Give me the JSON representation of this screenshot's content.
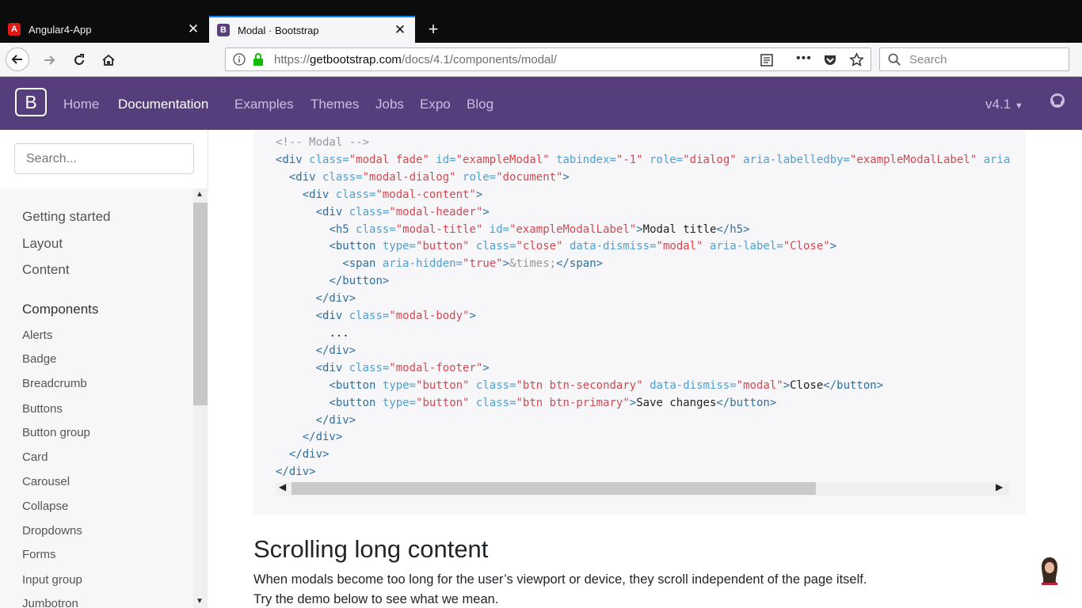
{
  "browser": {
    "tabs": [
      {
        "label": "Angular4-App",
        "icon": "angular-icon",
        "active": false
      },
      {
        "label": "Modal · Bootstrap",
        "icon": "bootstrap-icon",
        "active": true
      }
    ],
    "url_scheme": "https://",
    "url_host": "getbootstrap.com",
    "url_path": "/docs/4.1/components/modal/",
    "search_placeholder": "Search"
  },
  "site": {
    "brand": "B",
    "nav": [
      "Home",
      "Documentation",
      "Examples",
      "Themes",
      "Jobs",
      "Expo",
      "Blog"
    ],
    "active_nav": "Documentation",
    "version": "v4.1"
  },
  "sidebar": {
    "search_placeholder": "Search...",
    "groups": [
      "Getting started",
      "Layout",
      "Content"
    ],
    "components_heading": "Components",
    "components": [
      "Alerts",
      "Badge",
      "Breadcrumb",
      "Buttons",
      "Button group",
      "Card",
      "Carousel",
      "Collapse",
      "Dropdowns",
      "Forms",
      "Input group",
      "Jumbotron"
    ]
  },
  "main": {
    "section_title": "Scrolling long content",
    "section_text": "When modals become too long for the user’s viewport or device, they scroll independent of the page itself. Try the demo below to see what we mean."
  },
  "colors": {
    "header_bg": "#563d7c",
    "tag": "#2f6f9f",
    "attr": "#4f9fcf",
    "string": "#d44950",
    "comment": "#999999"
  }
}
